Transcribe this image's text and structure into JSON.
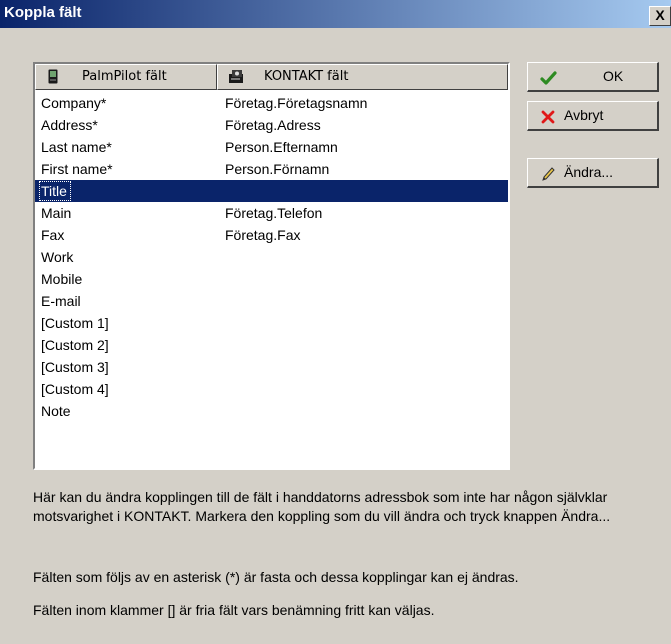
{
  "window": {
    "title": "Koppla fält",
    "close_label": "X"
  },
  "list": {
    "col1_header": "PalmPilot fält",
    "col2_header": "KONTAKT fält",
    "rows": [
      {
        "palm": "Company*",
        "kontakt": "Företag.Företagsnamn"
      },
      {
        "palm": "Address*",
        "kontakt": "Företag.Adress"
      },
      {
        "palm": "Last name*",
        "kontakt": "Person.Efternamn"
      },
      {
        "palm": "First name*",
        "kontakt": "Person.Förnamn"
      },
      {
        "palm": "Title",
        "kontakt": ""
      },
      {
        "palm": "Main",
        "kontakt": "Företag.Telefon"
      },
      {
        "palm": "Fax",
        "kontakt": "Företag.Fax"
      },
      {
        "palm": "Work",
        "kontakt": ""
      },
      {
        "palm": "Mobile",
        "kontakt": ""
      },
      {
        "palm": "E-mail",
        "kontakt": ""
      },
      {
        "palm": "[Custom 1]",
        "kontakt": ""
      },
      {
        "palm": "[Custom 2]",
        "kontakt": ""
      },
      {
        "palm": "[Custom 3]",
        "kontakt": ""
      },
      {
        "palm": "[Custom 4]",
        "kontakt": ""
      },
      {
        "palm": "Note",
        "kontakt": ""
      }
    ],
    "selected_index": 4
  },
  "buttons": {
    "ok": "OK",
    "cancel": "Avbryt",
    "edit": "Ändra..."
  },
  "description": {
    "para1": "Här kan du ändra kopplingen till de fält i handdatorns adressbok som inte har någon självklar motsvarighet i KONTAKT. Markera den koppling som du vill ändra och tryck knappen Ändra...",
    "para2": "Fälten som följs av en asterisk (*) är fasta och dessa kopplingar kan ej ändras.",
    "para3": "Fälten inom klammer [] är fria fält vars benämning fritt kan väljas."
  },
  "icons": {
    "col1": "palm-device-icon",
    "col2": "contact-cards-icon",
    "ok": "checkmark-icon",
    "cancel": "cross-icon",
    "edit": "pencil-icon"
  },
  "colors": {
    "titlebar": "#0a246a",
    "selection": "#0a246a",
    "face": "#d4d0c8"
  }
}
